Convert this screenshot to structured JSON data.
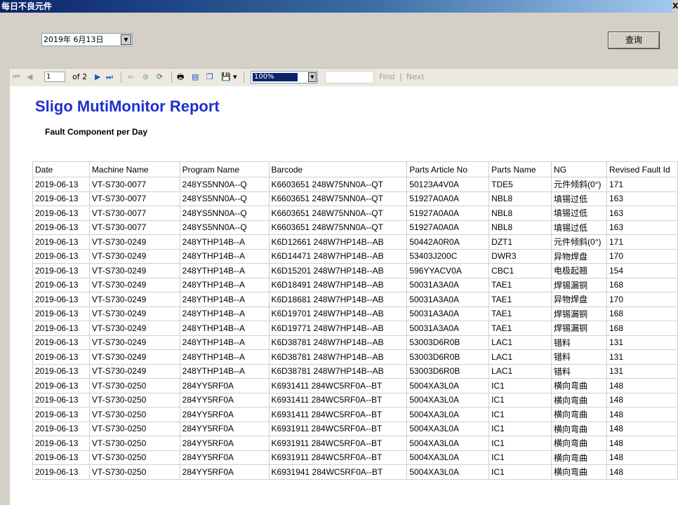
{
  "window": {
    "title": "每日不良元件",
    "close_glyph": "X"
  },
  "date_picker": {
    "value": "2019年 6月13日",
    "dropdown_glyph": "▼"
  },
  "query_button": {
    "label": "查询"
  },
  "toolbar": {
    "page_value": "1",
    "page_of": "of 2",
    "zoom_value": "100%",
    "zoom_dropdown_glyph": "▼",
    "find_label": "Find",
    "separator": "|",
    "next_label": "Next",
    "icons": {
      "first_page": "⏮",
      "prev_page": "◀",
      "next_page": "▶",
      "last_page": "⏭",
      "back": "⇐",
      "stop": "⊗",
      "refresh": "⟳",
      "print": "🖶",
      "print_layout": "▤",
      "page_setup": "❐",
      "export": "💾",
      "export_dropdown": "▾"
    }
  },
  "report": {
    "title": "Sligo MutiMonitor Report",
    "subtitle": "Fault Component per Day",
    "columns": [
      "Date",
      "Machine Name",
      "Program Name",
      "Barcode",
      "Parts Article No",
      "Parts Name",
      "NG",
      "Revised Fault Id"
    ],
    "rows": [
      [
        "2019-06-13",
        "VT-S730-0077",
        "248YS5NN0A--Q",
        "K6603651 248W75NN0A--QT",
        "50123A4V0A",
        "TDE5",
        "元件倾斜(0°)",
        "171"
      ],
      [
        "2019-06-13",
        "VT-S730-0077",
        "248YS5NN0A--Q",
        "K6603651 248W75NN0A--QT",
        "51927A0A0A",
        "NBL8",
        "填锡过低",
        "163"
      ],
      [
        "2019-06-13",
        "VT-S730-0077",
        "248YS5NN0A--Q",
        "K6603651 248W75NN0A--QT",
        "51927A0A0A",
        "NBL8",
        "填锡过低",
        "163"
      ],
      [
        "2019-06-13",
        "VT-S730-0077",
        "248YS5NN0A--Q",
        "K6603651 248W75NN0A--QT",
        "51927A0A0A",
        "NBL8",
        "填锡过低",
        "163"
      ],
      [
        "2019-06-13",
        "VT-S730-0249",
        "248YTHP14B--A",
        "K6D12661 248W7HP14B--AB",
        "50442A0R0A",
        "DZT1",
        "元件倾斜(0°)",
        "171"
      ],
      [
        "2019-06-13",
        "VT-S730-0249",
        "248YTHP14B--A",
        "K6D14471 248W7HP14B--AB",
        "53403J200C",
        "DWR3",
        "异物焊盘",
        "170"
      ],
      [
        "2019-06-13",
        "VT-S730-0249",
        "248YTHP14B--A",
        "K6D15201 248W7HP14B--AB",
        "596YYACV0A",
        "CBC1",
        "电极起翘",
        "154"
      ],
      [
        "2019-06-13",
        "VT-S730-0249",
        "248YTHP14B--A",
        "K6D18491 248W7HP14B--AB",
        "50031A3A0A",
        "TAE1",
        "焊锡漏铜",
        "168"
      ],
      [
        "2019-06-13",
        "VT-S730-0249",
        "248YTHP14B--A",
        "K6D18681 248W7HP14B--AB",
        "50031A3A0A",
        "TAE1",
        "异物焊盘",
        "170"
      ],
      [
        "2019-06-13",
        "VT-S730-0249",
        "248YTHP14B--A",
        "K6D19701 248W7HP14B--AB",
        "50031A3A0A",
        "TAE1",
        "焊锡漏铜",
        "168"
      ],
      [
        "2019-06-13",
        "VT-S730-0249",
        "248YTHP14B--A",
        "K6D19771 248W7HP14B--AB",
        "50031A3A0A",
        "TAE1",
        "焊锡漏铜",
        "168"
      ],
      [
        "2019-06-13",
        "VT-S730-0249",
        "248YTHP14B--A",
        "K6D38781 248W7HP14B--AB",
        "53003D6R0B",
        "LAC1",
        "错料",
        "131"
      ],
      [
        "2019-06-13",
        "VT-S730-0249",
        "248YTHP14B--A",
        "K6D38781 248W7HP14B--AB",
        "53003D6R0B",
        "LAC1",
        "错料",
        "131"
      ],
      [
        "2019-06-13",
        "VT-S730-0249",
        "248YTHP14B--A",
        "K6D38781 248W7HP14B--AB",
        "53003D6R0B",
        "LAC1",
        "错料",
        "131"
      ],
      [
        "2019-06-13",
        "VT-S730-0250",
        "284YY5RF0A",
        "K6931411 284WC5RF0A--BT",
        "5004XA3L0A",
        "IC1",
        "横向弯曲",
        "148"
      ],
      [
        "2019-06-13",
        "VT-S730-0250",
        "284YY5RF0A",
        "K6931411 284WC5RF0A--BT",
        "5004XA3L0A",
        "IC1",
        "横向弯曲",
        "148"
      ],
      [
        "2019-06-13",
        "VT-S730-0250",
        "284YY5RF0A",
        "K6931411 284WC5RF0A--BT",
        "5004XA3L0A",
        "IC1",
        "横向弯曲",
        "148"
      ],
      [
        "2019-06-13",
        "VT-S730-0250",
        "284YY5RF0A",
        "K6931911 284WC5RF0A--BT",
        "5004XA3L0A",
        "IC1",
        "横向弯曲",
        "148"
      ],
      [
        "2019-06-13",
        "VT-S730-0250",
        "284YY5RF0A",
        "K6931911 284WC5RF0A--BT",
        "5004XA3L0A",
        "IC1",
        "横向弯曲",
        "148"
      ],
      [
        "2019-06-13",
        "VT-S730-0250",
        "284YY5RF0A",
        "K6931911 284WC5RF0A--BT",
        "5004XA3L0A",
        "IC1",
        "横向弯曲",
        "148"
      ],
      [
        "2019-06-13",
        "VT-S730-0250",
        "284YY5RF0A",
        "K6931941 284WC5RF0A--BT",
        "5004XA3L0A",
        "IC1",
        "横向弯曲",
        "148"
      ]
    ]
  },
  "colors": {
    "report_title": "#1f2fcf",
    "titlebar": "#0a246a",
    "toolbar_icon_blue": "#1a55c8"
  }
}
